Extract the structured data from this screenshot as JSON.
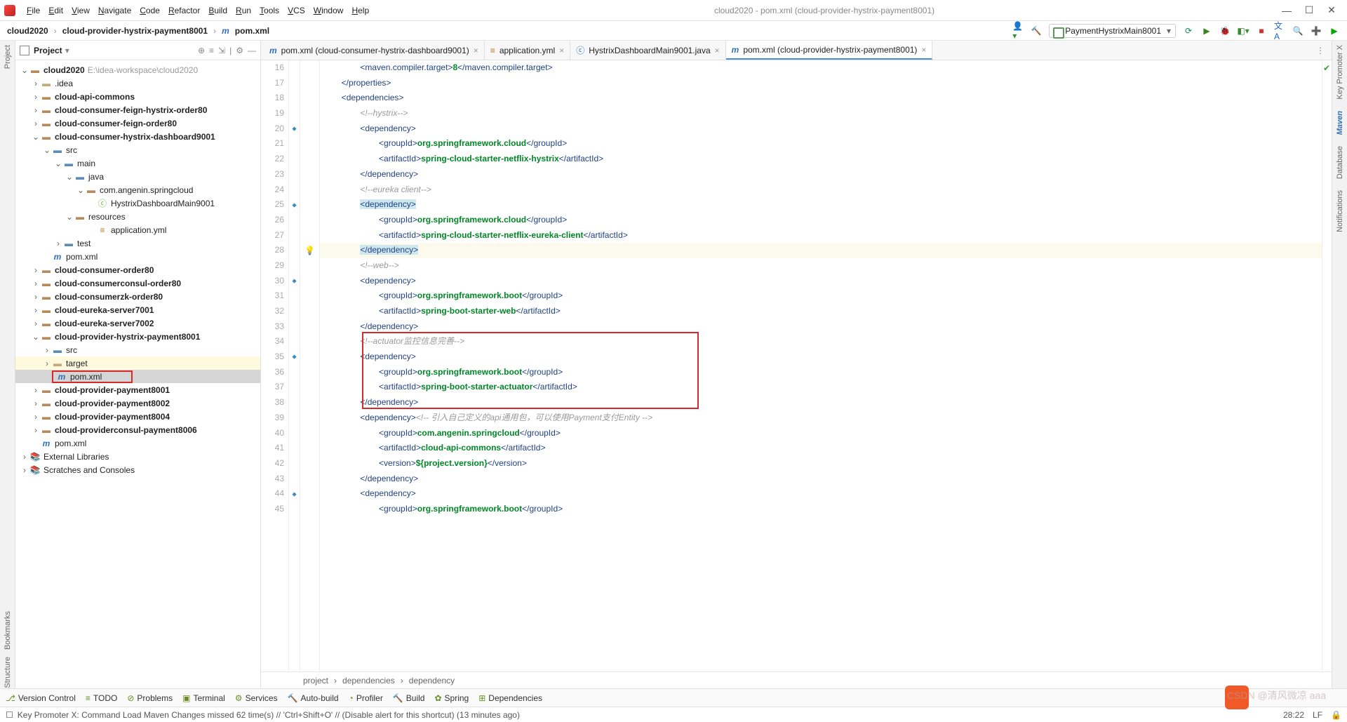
{
  "menu": {
    "items": [
      "File",
      "Edit",
      "View",
      "Navigate",
      "Code",
      "Refactor",
      "Build",
      "Run",
      "Tools",
      "VCS",
      "Window",
      "Help"
    ]
  },
  "title": "cloud2020 - pom.xml (cloud-provider-hystrix-payment8001)",
  "breadcrumbs": {
    "parts": [
      "cloud2020",
      "cloud-provider-hystrix-payment8001",
      "pom.xml"
    ]
  },
  "runconfig": "PaymentHystrixMain8001",
  "left_rail": [
    "Project"
  ],
  "left_rail_bottom": [
    "Bookmarks",
    "Structure"
  ],
  "right_rail": [
    "Key Promoter X",
    "Maven",
    "Database",
    "Notifications"
  ],
  "project_panel": {
    "title": "Project",
    "root": "cloud2020",
    "root_hint": "E:\\idea-workspace\\cloud2020"
  },
  "tree": [
    {
      "depth": 0,
      "tw": "v",
      "ic": "folder",
      "bold": true,
      "label": "cloud2020",
      "hint": "E:\\idea-workspace\\cloud2020"
    },
    {
      "depth": 1,
      "tw": ">",
      "ic": "folder light",
      "label": ".idea"
    },
    {
      "depth": 1,
      "tw": ">",
      "ic": "folder",
      "bold": true,
      "label": "cloud-api-commons"
    },
    {
      "depth": 1,
      "tw": ">",
      "ic": "folder",
      "bold": true,
      "label": "cloud-consumer-feign-hystrix-order80"
    },
    {
      "depth": 1,
      "tw": ">",
      "ic": "folder",
      "bold": true,
      "label": "cloud-consumer-feign-order80"
    },
    {
      "depth": 1,
      "tw": "v",
      "ic": "folder",
      "bold": true,
      "label": "cloud-consumer-hystrix-dashboard9001"
    },
    {
      "depth": 2,
      "tw": "v",
      "ic": "folder blue",
      "label": "src"
    },
    {
      "depth": 3,
      "tw": "v",
      "ic": "folder blue",
      "label": "main"
    },
    {
      "depth": 4,
      "tw": "v",
      "ic": "folder blue",
      "label": "java"
    },
    {
      "depth": 5,
      "tw": "v",
      "ic": "folder",
      "label": "com.angenin.springcloud"
    },
    {
      "depth": 6,
      "tw": "",
      "ic": "file-c",
      "label": "HystrixDashboardMain9001"
    },
    {
      "depth": 4,
      "tw": "v",
      "ic": "folder",
      "label": "resources"
    },
    {
      "depth": 6,
      "tw": "",
      "ic": "file-y",
      "label": "application.yml"
    },
    {
      "depth": 3,
      "tw": ">",
      "ic": "folder blue",
      "label": "test"
    },
    {
      "depth": 2,
      "tw": "",
      "ic": "file-m",
      "label": "pom.xml"
    },
    {
      "depth": 1,
      "tw": ">",
      "ic": "folder",
      "bold": true,
      "label": "cloud-consumer-order80"
    },
    {
      "depth": 1,
      "tw": ">",
      "ic": "folder",
      "bold": true,
      "label": "cloud-consumerconsul-order80"
    },
    {
      "depth": 1,
      "tw": ">",
      "ic": "folder",
      "bold": true,
      "label": "cloud-consumerzk-order80"
    },
    {
      "depth": 1,
      "tw": ">",
      "ic": "folder",
      "bold": true,
      "label": "cloud-eureka-server7001"
    },
    {
      "depth": 1,
      "tw": ">",
      "ic": "folder",
      "bold": true,
      "label": "cloud-eureka-server7002"
    },
    {
      "depth": 1,
      "tw": "v",
      "ic": "folder",
      "bold": true,
      "label": "cloud-provider-hystrix-payment8001"
    },
    {
      "depth": 2,
      "tw": ">",
      "ic": "folder blue",
      "label": "src"
    },
    {
      "depth": 2,
      "tw": ">",
      "ic": "folder light",
      "label": "target",
      "highlight": true
    },
    {
      "depth": 2,
      "tw": "",
      "ic": "file-m",
      "label": "pom.xml",
      "selected": true,
      "redbox": true
    },
    {
      "depth": 1,
      "tw": ">",
      "ic": "folder",
      "bold": true,
      "label": "cloud-provider-payment8001"
    },
    {
      "depth": 1,
      "tw": ">",
      "ic": "folder",
      "bold": true,
      "label": "cloud-provider-payment8002"
    },
    {
      "depth": 1,
      "tw": ">",
      "ic": "folder",
      "bold": true,
      "label": "cloud-provider-payment8004"
    },
    {
      "depth": 1,
      "tw": ">",
      "ic": "folder",
      "bold": true,
      "label": "cloud-providerconsul-payment8006"
    },
    {
      "depth": 1,
      "tw": "",
      "ic": "file-m",
      "label": "pom.xml"
    },
    {
      "depth": 0,
      "tw": ">",
      "ic": "lib",
      "label": "External Libraries"
    },
    {
      "depth": 0,
      "tw": ">",
      "ic": "lib",
      "label": "Scratches and Consoles"
    }
  ],
  "tabs": [
    {
      "icon": "m",
      "label": "pom.xml (cloud-consumer-hystrix-dashboard9001)"
    },
    {
      "icon": "y",
      "label": "application.yml"
    },
    {
      "icon": "c",
      "label": "HystrixDashboardMain9001.java"
    },
    {
      "icon": "m",
      "label": "pom.xml (cloud-provider-hystrix-payment8001)",
      "active": true
    }
  ],
  "code": {
    "first_line": 16,
    "lines": [
      {
        "ind": 4,
        "parts": [
          {
            "c": "brk",
            "t": "<"
          },
          {
            "c": "tag",
            "t": "maven.compiler.target"
          },
          {
            "c": "brk",
            "t": ">"
          },
          {
            "c": "txt",
            "t": "8"
          },
          {
            "c": "brk",
            "t": "</"
          },
          {
            "c": "tag",
            "t": "maven.compiler.target"
          },
          {
            "c": "brk",
            "t": ">"
          }
        ]
      },
      {
        "ind": 2,
        "parts": [
          {
            "c": "brk",
            "t": "</"
          },
          {
            "c": "tag",
            "t": "properties"
          },
          {
            "c": "brk",
            "t": ">"
          }
        ]
      },
      {
        "ind": 2,
        "parts": [
          {
            "c": "brk",
            "t": "<"
          },
          {
            "c": "tag",
            "t": "dependencies"
          },
          {
            "c": "brk",
            "t": ">"
          }
        ]
      },
      {
        "ind": 4,
        "parts": [
          {
            "c": "cmt",
            "t": "<!--hystrix-->"
          }
        ]
      },
      {
        "ind": 4,
        "parts": [
          {
            "c": "brk",
            "t": "<"
          },
          {
            "c": "tag",
            "t": "dependency"
          },
          {
            "c": "brk",
            "t": ">"
          }
        ],
        "mk": "⬥"
      },
      {
        "ind": 6,
        "parts": [
          {
            "c": "brk",
            "t": "<"
          },
          {
            "c": "tag",
            "t": "groupId"
          },
          {
            "c": "brk",
            "t": ">"
          },
          {
            "c": "txt",
            "t": "org.springframework.cloud"
          },
          {
            "c": "brk",
            "t": "</"
          },
          {
            "c": "tag",
            "t": "groupId"
          },
          {
            "c": "brk",
            "t": ">"
          }
        ]
      },
      {
        "ind": 6,
        "parts": [
          {
            "c": "brk",
            "t": "<"
          },
          {
            "c": "tag",
            "t": "artifactId"
          },
          {
            "c": "brk",
            "t": ">"
          },
          {
            "c": "txt",
            "t": "spring-cloud-starter-netflix-hystrix"
          },
          {
            "c": "brk",
            "t": "</"
          },
          {
            "c": "tag",
            "t": "artifactId"
          },
          {
            "c": "brk",
            "t": ">"
          }
        ]
      },
      {
        "ind": 4,
        "parts": [
          {
            "c": "brk",
            "t": "</"
          },
          {
            "c": "tag",
            "t": "dependency"
          },
          {
            "c": "brk",
            "t": ">"
          }
        ]
      },
      {
        "ind": 4,
        "parts": [
          {
            "c": "cmt",
            "t": "<!--eureka client-->"
          }
        ]
      },
      {
        "ind": 4,
        "parts": [
          {
            "c": "brk",
            "t": "<",
            "sel": true
          },
          {
            "c": "tag",
            "t": "dependency",
            "sel": true
          },
          {
            "c": "brk",
            "t": ">",
            "sel": true
          }
        ],
        "mk": "⬥"
      },
      {
        "ind": 6,
        "parts": [
          {
            "c": "brk",
            "t": "<"
          },
          {
            "c": "tag",
            "t": "groupId"
          },
          {
            "c": "brk",
            "t": ">"
          },
          {
            "c": "txt",
            "t": "org.springframework.cloud"
          },
          {
            "c": "brk",
            "t": "</"
          },
          {
            "c": "tag",
            "t": "groupId"
          },
          {
            "c": "brk",
            "t": ">"
          }
        ]
      },
      {
        "ind": 6,
        "parts": [
          {
            "c": "brk",
            "t": "<"
          },
          {
            "c": "tag",
            "t": "artifactId"
          },
          {
            "c": "brk",
            "t": ">"
          },
          {
            "c": "txt",
            "t": "spring-cloud-starter-netflix-eureka-client"
          },
          {
            "c": "brk",
            "t": "</"
          },
          {
            "c": "tag",
            "t": "artifactId"
          },
          {
            "c": "brk",
            "t": ">"
          }
        ]
      },
      {
        "ind": 4,
        "caret": true,
        "bulb": true,
        "parts": [
          {
            "c": "brk",
            "t": "</",
            "sel": true
          },
          {
            "c": "tag",
            "t": "dependency",
            "sel": true
          },
          {
            "c": "brk",
            "t": ">",
            "sel": true
          }
        ]
      },
      {
        "ind": 4,
        "parts": [
          {
            "c": "cmt",
            "t": "<!--web-->"
          }
        ]
      },
      {
        "ind": 4,
        "parts": [
          {
            "c": "brk",
            "t": "<"
          },
          {
            "c": "tag",
            "t": "dependency"
          },
          {
            "c": "brk",
            "t": ">"
          }
        ],
        "mk": "⬥"
      },
      {
        "ind": 6,
        "parts": [
          {
            "c": "brk",
            "t": "<"
          },
          {
            "c": "tag",
            "t": "groupId"
          },
          {
            "c": "brk",
            "t": ">"
          },
          {
            "c": "txt",
            "t": "org.springframework.boot"
          },
          {
            "c": "brk",
            "t": "</"
          },
          {
            "c": "tag",
            "t": "groupId"
          },
          {
            "c": "brk",
            "t": ">"
          }
        ]
      },
      {
        "ind": 6,
        "parts": [
          {
            "c": "brk",
            "t": "<"
          },
          {
            "c": "tag",
            "t": "artifactId"
          },
          {
            "c": "brk",
            "t": ">"
          },
          {
            "c": "txt",
            "t": "spring-boot-starter-web"
          },
          {
            "c": "brk",
            "t": "</"
          },
          {
            "c": "tag",
            "t": "artifactId"
          },
          {
            "c": "brk",
            "t": ">"
          }
        ]
      },
      {
        "ind": 4,
        "parts": [
          {
            "c": "brk",
            "t": "</"
          },
          {
            "c": "tag",
            "t": "dependency"
          },
          {
            "c": "brk",
            "t": ">"
          }
        ]
      },
      {
        "ind": 4,
        "parts": [
          {
            "c": "cmt",
            "t": "<!--actuator监控信息完善-->"
          }
        ]
      },
      {
        "ind": 4,
        "parts": [
          {
            "c": "brk",
            "t": "<"
          },
          {
            "c": "tag",
            "t": "dependency"
          },
          {
            "c": "brk",
            "t": ">"
          }
        ],
        "mk": "⬥"
      },
      {
        "ind": 6,
        "parts": [
          {
            "c": "brk",
            "t": "<"
          },
          {
            "c": "tag",
            "t": "groupId"
          },
          {
            "c": "brk",
            "t": ">"
          },
          {
            "c": "txt",
            "t": "org.springframework.boot"
          },
          {
            "c": "brk",
            "t": "</"
          },
          {
            "c": "tag",
            "t": "groupId"
          },
          {
            "c": "brk",
            "t": ">"
          }
        ]
      },
      {
        "ind": 6,
        "parts": [
          {
            "c": "brk",
            "t": "<"
          },
          {
            "c": "tag",
            "t": "artifactId"
          },
          {
            "c": "brk",
            "t": ">"
          },
          {
            "c": "txt",
            "t": "spring-boot-starter-actuator"
          },
          {
            "c": "brk",
            "t": "</"
          },
          {
            "c": "tag",
            "t": "artifactId"
          },
          {
            "c": "brk",
            "t": ">"
          }
        ]
      },
      {
        "ind": 4,
        "parts": [
          {
            "c": "brk",
            "t": "</"
          },
          {
            "c": "tag",
            "t": "dependency"
          },
          {
            "c": "brk",
            "t": ">"
          }
        ]
      },
      {
        "ind": 4,
        "parts": [
          {
            "c": "brk",
            "t": "<"
          },
          {
            "c": "tag",
            "t": "dependency"
          },
          {
            "c": "brk",
            "t": ">"
          },
          {
            "c": "cmt",
            "t": "<!-- 引入自己定义的api通用包，可以使用Payment支付Entity -->"
          }
        ]
      },
      {
        "ind": 6,
        "parts": [
          {
            "c": "brk",
            "t": "<"
          },
          {
            "c": "tag",
            "t": "groupId"
          },
          {
            "c": "brk",
            "t": ">"
          },
          {
            "c": "txt",
            "t": "com.angenin.springcloud"
          },
          {
            "c": "brk",
            "t": "</"
          },
          {
            "c": "tag",
            "t": "groupId"
          },
          {
            "c": "brk",
            "t": ">"
          }
        ]
      },
      {
        "ind": 6,
        "parts": [
          {
            "c": "brk",
            "t": "<"
          },
          {
            "c": "tag",
            "t": "artifactId"
          },
          {
            "c": "brk",
            "t": ">"
          },
          {
            "c": "txt",
            "t": "cloud-api-commons"
          },
          {
            "c": "brk",
            "t": "</"
          },
          {
            "c": "tag",
            "t": "artifactId"
          },
          {
            "c": "brk",
            "t": ">"
          }
        ]
      },
      {
        "ind": 6,
        "parts": [
          {
            "c": "brk",
            "t": "<"
          },
          {
            "c": "tag",
            "t": "version"
          },
          {
            "c": "brk",
            "t": ">"
          },
          {
            "c": "txt",
            "t": "${project.version}"
          },
          {
            "c": "brk",
            "t": "</"
          },
          {
            "c": "tag",
            "t": "version"
          },
          {
            "c": "brk",
            "t": ">"
          }
        ]
      },
      {
        "ind": 4,
        "parts": [
          {
            "c": "brk",
            "t": "</"
          },
          {
            "c": "tag",
            "t": "dependency"
          },
          {
            "c": "brk",
            "t": ">"
          }
        ]
      },
      {
        "ind": 4,
        "parts": [
          {
            "c": "brk",
            "t": "<"
          },
          {
            "c": "tag",
            "t": "dependency"
          },
          {
            "c": "brk",
            "t": ">"
          }
        ],
        "mk": "⬥"
      },
      {
        "ind": 6,
        "parts": [
          {
            "c": "brk",
            "t": "<"
          },
          {
            "c": "tag",
            "t": "groupId"
          },
          {
            "c": "brk",
            "t": ">"
          },
          {
            "c": "txt",
            "t": "org.springframework.boot"
          },
          {
            "c": "brk",
            "t": "</"
          },
          {
            "c": "tag",
            "t": "groupId"
          },
          {
            "c": "brk",
            "t": ">"
          }
        ]
      }
    ],
    "red_box": {
      "from": 34,
      "to": 38
    }
  },
  "editor_breadcrumb": [
    "project",
    "dependencies",
    "dependency"
  ],
  "bottombar": [
    "Version Control",
    "TODO",
    "Problems",
    "Terminal",
    "Services",
    "Auto-build",
    "Profiler",
    "Build",
    "Spring",
    "Dependencies"
  ],
  "status": {
    "msg": "Key Promoter X: Command Load Maven Changes missed 62 time(s) // 'Ctrl+Shift+O' // (Disable alert for this shortcut) (13 minutes ago)",
    "pos": "28:22",
    "enc": "LF",
    "watermark": "CSDN @清风微凉 aaa"
  }
}
